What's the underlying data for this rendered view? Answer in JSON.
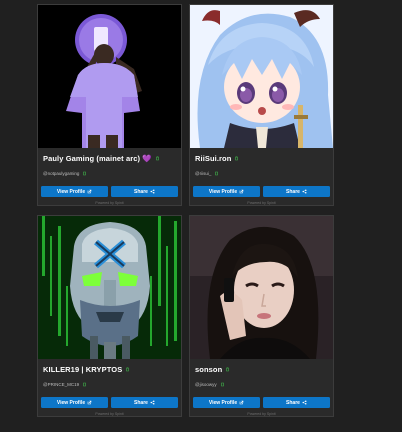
{
  "colors": {
    "background": "#202020",
    "card": "#2a2a2a",
    "button": "#0d76c8",
    "verified_green": "#3fb44a"
  },
  "cards": [
    {
      "name": "Pauly Gaming (mainet arc) 💜",
      "handle": "@notpaulygaming",
      "image": "person-purple-shirt-silhouette"
    },
    {
      "name": "RiiSui.ron",
      "handle": "@riisui_",
      "image": "anime-girl-blue-hair"
    },
    {
      "name": "KILLER19 | KRYPTOS",
      "handle": "@PRINCE_MC19",
      "image": "cyborg-head-green-matrix"
    },
    {
      "name": "sonson",
      "handle": "@jisoowyy",
      "image": "woman-dark-hair-portrait"
    }
  ],
  "buttons": {
    "view_profile": "View Profile",
    "share": "Share"
  },
  "footer": {
    "powered_by": "Powered by Spinit"
  }
}
